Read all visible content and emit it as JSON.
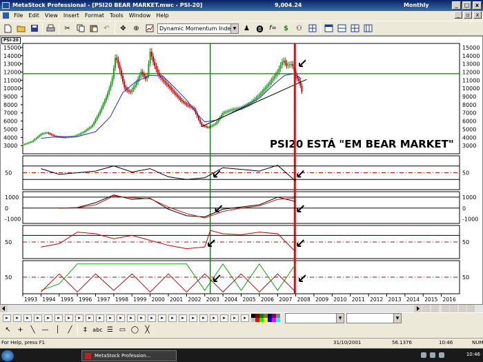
{
  "window": {
    "title": "MetaStock Professional - [PSI20 BEAR MARKET.mwc - PSI-20]",
    "price": "9,004.24",
    "periodicity": "Monthly",
    "buttons": {
      "minimize": "_",
      "maximize": "□",
      "close": "x"
    }
  },
  "menu": [
    "File",
    "Edit",
    "View",
    "Insert",
    "Format",
    "Tools",
    "Window",
    "Help"
  ],
  "mdi_buttons": {
    "minimize": "_",
    "restore": "▫",
    "close": "x"
  },
  "toolbar": {
    "indicator_select": "Dynamic Momentum Index",
    "icons": [
      "new-icon",
      "open-icon",
      "save-icon",
      "print-icon",
      "cut-icon",
      "copy-icon",
      "paste-icon",
      "undo-icon",
      "crosshair-icon",
      "zoom-icon",
      "chart-icon",
      "properties-icon",
      "fx-icon",
      "dollar-icon",
      "binoculars-icon",
      "grid-icon",
      "layout1-icon",
      "layout2-icon",
      "layout3-icon",
      "layout4-icon"
    ]
  },
  "chart_window": {
    "tab": "PSI-20"
  },
  "chart_data": {
    "type": "line",
    "title": "",
    "annotation": "PSI20 ESTÁ \"EM BEAR MARKET\"",
    "x_ticks": [
      "1993",
      "1994",
      "1995",
      "1996",
      "1997",
      "1998",
      "1999",
      "2000",
      "2001",
      "2002",
      "2003",
      "2004",
      "2005",
      "2006",
      "2007",
      "2008",
      "2009",
      "2010",
      "2011",
      "2012",
      "2013",
      "2014",
      "2015",
      "2016"
    ],
    "main_panel": {
      "ylim": [
        2000,
        15500
      ],
      "y_ticks": [
        3000,
        4000,
        5000,
        6000,
        7000,
        8000,
        9000,
        10000,
        11000,
        12000,
        13000,
        14000,
        15000
      ],
      "y_tick_labels": [
        "3000",
        "4000",
        "5000",
        "6000",
        "7000",
        "8000",
        "9000",
        "10000",
        "11000",
        "12000",
        "13000",
        "14000",
        "15000"
      ],
      "horizontal_level": 11800,
      "series": [
        {
          "kind": "price",
          "x": [
            1993.0,
            1993.5,
            1994.0,
            1994.3,
            1994.8,
            1995.3,
            1995.8,
            1996.3,
            1996.8,
            1997.2,
            1997.6,
            1997.9,
            1998.1,
            1998.3,
            1998.6,
            1998.9,
            1999.2,
            1999.5,
            1999.8,
            2000.0,
            2000.2,
            2000.5,
            2000.9,
            2001.3,
            2001.7,
            2002.0,
            2002.4,
            2002.8,
            2003.2,
            2003.6,
            2004.0,
            2004.5,
            2005.0,
            2005.5,
            2006.0,
            2006.5,
            2007.0,
            2007.3,
            2007.5,
            2007.8,
            2008.0,
            2008.2,
            2008.4
          ],
          "y": [
            3100,
            3500,
            4400,
            4600,
            4100,
            4000,
            4100,
            4600,
            5400,
            7000,
            9000,
            11000,
            14000,
            12500,
            10000,
            9500,
            10500,
            12000,
            11000,
            14500,
            13000,
            11500,
            10500,
            9500,
            8500,
            8000,
            7500,
            5500,
            5200,
            5700,
            7000,
            7400,
            7600,
            8200,
            9200,
            10500,
            12000,
            13500,
            12800,
            13000,
            11500,
            10800,
            9004
          ]
        },
        {
          "kind": "moving_average",
          "x": [
            1994.0,
            1995.0,
            1996.0,
            1997.0,
            1997.8,
            1998.5,
            1999.2,
            2000.0,
            2000.7,
            2001.3,
            2002.0,
            2002.6,
            2003.0,
            2003.6,
            2004.2,
            2005.0,
            2006.0,
            2006.8,
            2007.4,
            2007.9,
            2008.3
          ],
          "y": [
            3900,
            4100,
            4100,
            4700,
            6500,
            9500,
            10800,
            11600,
            11500,
            10200,
            8600,
            6800,
            5900,
            6100,
            6700,
            7600,
            8800,
            10500,
            11600,
            11800,
            11200
          ]
        }
      ],
      "trendline": {
        "x": [
          2002.8,
          2008.6
        ],
        "y": [
          5300,
          11100
        ]
      },
      "vertical_markers": [
        {
          "x": 2003.3,
          "color": "green"
        },
        {
          "x": 2007.95,
          "color": "red"
        }
      ],
      "arrow_marks_x": [
        2008.05
      ]
    },
    "oscillator_panels": [
      {
        "name": "panel-2",
        "ylim": [
          0,
          100
        ],
        "y_tick_labels": [
          "50"
        ],
        "levels": [
          50,
          70,
          30
        ],
        "series": [
          {
            "x": [
              1994,
              1995,
              1996,
              1997,
              1998,
              1999,
              2000,
              2001,
              2002,
              2003,
              2004,
              2005,
              2006,
              2007,
              2008
            ],
            "y": [
              62,
              45,
              50,
              55,
              70,
              52,
              62,
              38,
              30,
              35,
              65,
              60,
              55,
              72,
              25
            ]
          }
        ],
        "arrow_marks_x": [
          2003.5,
          2008.1
        ]
      },
      {
        "name": "panel-3",
        "ylim": [
          -1400,
          1500
        ],
        "y_tick_labels": [
          "1000",
          "0",
          "-1000"
        ],
        "levels": [
          1000,
          0
        ],
        "series": [
          {
            "x": [
              1995,
              1996,
              1997,
              1998,
              1999,
              2000,
              2001,
              2002,
              2003,
              2004,
              2005,
              2006,
              2007,
              2008
            ],
            "y": [
              0,
              50,
              500,
              1200,
              800,
              900,
              -100,
              -700,
              -800,
              -100,
              100,
              300,
              1000,
              600
            ]
          },
          {
            "x": [
              1995,
              1996,
              1997,
              1998,
              1999,
              2000,
              2001,
              2002,
              2003,
              2004,
              2005,
              2006,
              2007,
              2008
            ],
            "y": [
              0,
              20,
              300,
              1100,
              950,
              850,
              100,
              -500,
              -900,
              -300,
              0,
              200,
              800,
              900
            ]
          }
        ],
        "arrow_marks_x": [
          2003.6,
          2008.1
        ]
      },
      {
        "name": "panel-4",
        "ylim": [
          0,
          100
        ],
        "y_tick_labels": [
          "50"
        ],
        "levels": [
          50,
          70
        ],
        "series": [
          {
            "x": [
              1994,
              1995,
              1996,
              1997,
              1998,
              1999,
              2000,
              2001,
              2002,
              2003,
              2003.3,
              2004,
              2005,
              2006,
              2007,
              2008
            ],
            "y": [
              35,
              45,
              80,
              75,
              60,
              70,
              55,
              40,
              30,
              35,
              85,
              75,
              72,
              80,
              75,
              20
            ]
          }
        ],
        "arrow_marks_x": [
          2003.2,
          2008.1
        ]
      },
      {
        "name": "panel-5",
        "ylim": [
          0,
          100
        ],
        "y_tick_labels": [
          "50"
        ],
        "levels": [
          50
        ],
        "series": [
          {
            "x": [
              1994,
              1995,
              1996,
              1997,
              2002,
              2003,
              2004,
              2005,
              2006,
              2007,
              2008
            ],
            "y": [
              10,
              30,
              90,
              90,
              90,
              10,
              90,
              10,
              90,
              10,
              90
            ]
          },
          {
            "x": [
              1994,
              1995,
              1996,
              1997,
              1998,
              1999,
              2000,
              2001,
              2002,
              2003,
              2004,
              2005,
              2006,
              2007,
              2008
            ],
            "y": [
              5,
              60,
              5,
              60,
              10,
              60,
              5,
              60,
              5,
              60,
              5,
              60,
              5,
              60,
              5
            ]
          }
        ],
        "arrow_marks_x": [
          2003.5,
          2008.2
        ]
      }
    ]
  },
  "status": {
    "help": "For Help, press F1",
    "date": "31/10/2001",
    "value": "56.1376",
    "time": "10:46",
    "mode": "NUM"
  },
  "taskbar": {
    "task_label": "MetaStock Profession...",
    "clock": "10:46"
  }
}
